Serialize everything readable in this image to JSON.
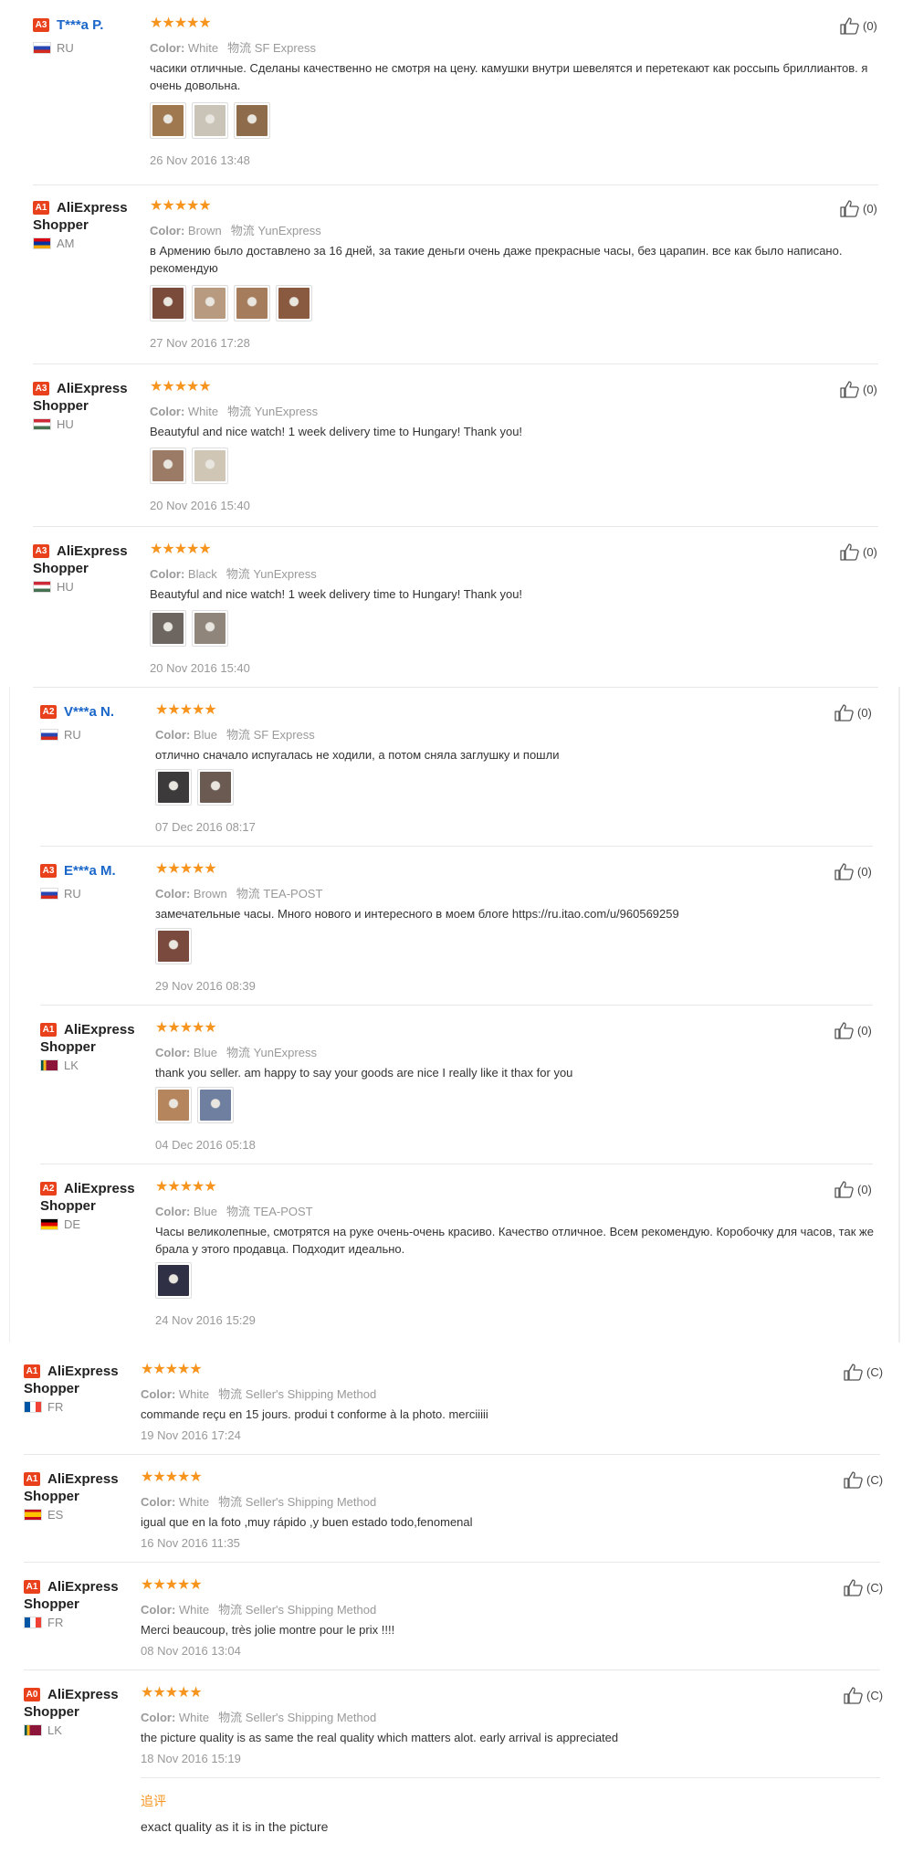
{
  "reviews": [
    {
      "badge": "A3",
      "badge_color": "#e8411b",
      "name": "T***a P.",
      "country": "RU",
      "flag": "ru",
      "stars": "★★★★★",
      "color_label": "Color:",
      "color_value": "White",
      "ship_label": "物流",
      "ship_value": "SF Express",
      "text": "часики отличные. Сделаны качественно не смотря на цену. камушки внутри шевелятся и перетекают как россыпь бриллиантов. я очень довольна.",
      "photos": [
        "#a07850",
        "#c9c3b8",
        "#8e6b4a"
      ],
      "date": "26 Nov 2016 13:48",
      "likes": "(0)"
    },
    {
      "badge": "A1",
      "badge_color": "#e8411b",
      "name": "AliExpress Shopper",
      "country": "AM",
      "flag": "am",
      "stars": "★★★★★",
      "color_label": "Color:",
      "color_value": "Brown",
      "ship_label": "物流",
      "ship_value": "YunExpress",
      "text": "в Армению было доставлено за 16 дней, за такие деньги очень даже прекрасные часы, без царапин. все как было написано. рекомендую",
      "photos": [
        "#7a4b3a",
        "#b79a80",
        "#a57d5c",
        "#8a5a40"
      ],
      "date": "27 Nov 2016 17:28",
      "likes": "(0)"
    },
    {
      "badge": "A3",
      "badge_color": "#e8411b",
      "name": "AliExpress Shopper",
      "country": "HU",
      "flag": "hu",
      "stars": "★★★★★",
      "color_label": "Color:",
      "color_value": "White",
      "ship_label": "物流",
      "ship_value": "YunExpress",
      "text": "Beautyful and nice watch! 1 week delivery time to Hungary! Thank you!",
      "photos": [
        "#9b7a66",
        "#cfc6b6"
      ],
      "date": "20 Nov 2016 15:40",
      "likes": "(0)"
    },
    {
      "badge": "A3",
      "badge_color": "#e8411b",
      "name": "AliExpress Shopper",
      "country": "HU",
      "flag": "hu",
      "stars": "★★★★★",
      "color_label": "Color:",
      "color_value": "Black",
      "ship_label": "物流",
      "ship_value": "YunExpress",
      "text": "Beautyful and nice watch! 1 week delivery time to Hungary! Thank you!",
      "photos": [
        "#6d6660",
        "#8f857a"
      ],
      "date": "20 Nov 2016 15:40",
      "likes": "(0)"
    },
    {
      "badge": "A2",
      "badge_color": "#e8411b",
      "name": "V***a N.",
      "country": "RU",
      "flag": "ru",
      "stars": "★★★★★",
      "color_label": "Color:",
      "color_value": "Blue",
      "ship_label": "物流",
      "ship_value": "SF Express",
      "text": "отлично сначало испугалась не ходили, а потом сняла заглушку и пошли",
      "photos": [
        "#3d3a3c",
        "#6b5a52"
      ],
      "date": "07 Dec 2016 08:17",
      "likes": "(0)"
    },
    {
      "badge": "A3",
      "badge_color": "#e8411b",
      "name": "E***a M.",
      "country": "RU",
      "flag": "ru",
      "stars": "★★★★★",
      "color_label": "Color:",
      "color_value": "Brown",
      "ship_label": "物流",
      "ship_value": "TEA-POST",
      "text": "замечательные часы. Много нового и интересного в моем блоге https://ru.itao.com/u/960569259",
      "photos": [
        "#7a4a3e"
      ],
      "date": "29 Nov 2016 08:39",
      "likes": "(0)"
    },
    {
      "badge": "A1",
      "badge_color": "#e8411b",
      "name": "AliExpress Shopper",
      "country": "LK",
      "flag": "lk",
      "stars": "★★★★★",
      "color_label": "Color:",
      "color_value": "Blue",
      "ship_label": "物流",
      "ship_value": "YunExpress",
      "text": "thank you seller. am happy to say your goods are nice I really like it thax for you",
      "photos": [
        "#b5865e",
        "#6f7fa0"
      ],
      "date": "04 Dec 2016 05:18",
      "likes": "(0)"
    },
    {
      "badge": "A2",
      "badge_color": "#e8411b",
      "name": "AliExpress Shopper",
      "country": "DE",
      "flag": "de",
      "stars": "★★★★★",
      "color_label": "Color:",
      "color_value": "Blue",
      "ship_label": "物流",
      "ship_value": "TEA-POST",
      "text": "Часы великолепные, смотрятся на руке очень-очень красиво. Качество отличное. Всем рекомендую. Коробочку для часов, так же брала у этого продавца. Подходит идеально.",
      "photos": [
        "#2f2f45"
      ],
      "date": "24 Nov 2016 15:29",
      "likes": "(0)"
    },
    {
      "badge": "A1",
      "badge_color": "#e8411b",
      "name": "AliExpress Shopper",
      "country": "FR",
      "flag": "fr",
      "stars": "★★★★★",
      "color_label": "Color:",
      "color_value": "White",
      "ship_label": "物流",
      "ship_value": "Seller's Shipping Method",
      "text": "commande reçu en 15 jours. produi t conforme à la photo. merciiiii",
      "photos": [],
      "date": "19 Nov 2016 17:24",
      "likes": "(C)"
    },
    {
      "badge": "A1",
      "badge_color": "#e8411b",
      "name": "AliExpress Shopper",
      "country": "ES",
      "flag": "es",
      "stars": "★★★★★",
      "color_label": "Color:",
      "color_value": "White",
      "ship_label": "物流",
      "ship_value": "Seller's Shipping Method",
      "text": "igual que en la foto ,muy rápido ,y buen estado todo,fenomenal",
      "photos": [],
      "date": "16 Nov 2016 11:35",
      "likes": "(C)"
    },
    {
      "badge": "A1",
      "badge_color": "#e8411b",
      "name": "AliExpress Shopper",
      "country": "FR",
      "flag": "fr",
      "stars": "★★★★★",
      "color_label": "Color:",
      "color_value": "White",
      "ship_label": "物流",
      "ship_value": "Seller's Shipping Method",
      "text": "Merci beaucoup, très jolie montre pour le prix !!!!",
      "photos": [],
      "date": "08 Nov 2016 13:04",
      "likes": "(C)"
    },
    {
      "badge": "A0",
      "badge_color": "#e8411b",
      "name": "AliExpress Shopper",
      "country": "LK",
      "flag": "lk",
      "stars": "★★★★★",
      "color_label": "Color:",
      "color_value": "White",
      "ship_label": "物流",
      "ship_value": "Seller's Shipping Method",
      "text": "the picture quality is as same the real quality which matters alot. early arrival is appreciated",
      "photos": [],
      "date": "18 Nov 2016 15:19",
      "likes": "(C)",
      "additional_title": "追评",
      "additional_text": "exact quality as it is in the picture"
    }
  ]
}
